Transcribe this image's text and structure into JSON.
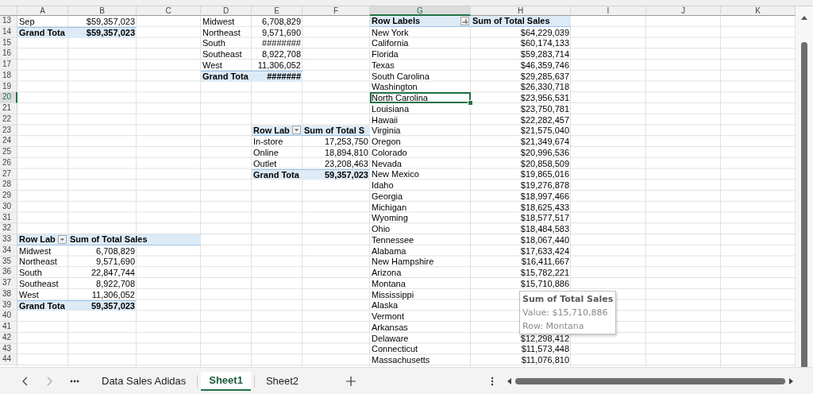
{
  "columns": [
    {
      "label": "A",
      "selected": false
    },
    {
      "label": "B",
      "selected": false
    },
    {
      "label": "C",
      "selected": false
    },
    {
      "label": "D",
      "selected": false
    },
    {
      "label": "E",
      "selected": false
    },
    {
      "label": "F",
      "selected": false
    },
    {
      "label": "G",
      "selected": true
    },
    {
      "label": "H",
      "selected": false
    },
    {
      "label": "I",
      "selected": false
    },
    {
      "label": "J",
      "selected": false
    },
    {
      "label": "K",
      "selected": false
    }
  ],
  "rows": [
    {
      "label": "13",
      "selected": false,
      "cells": [
        {
          "text": "Sep",
          "kind": "label"
        },
        {
          "text": "$59,357,023",
          "kind": "value"
        },
        null,
        {
          "text": "Midwest",
          "kind": "label"
        },
        {
          "text": "6,708,829",
          "kind": "value"
        },
        null,
        {
          "text": "Row Labels",
          "kind": "label",
          "header": true,
          "filter": true,
          "sorted": true
        },
        {
          "text": "Sum of Total Sales",
          "kind": "label",
          "header": true
        }
      ]
    },
    {
      "label": "14",
      "selected": false,
      "cells": [
        {
          "text": "Grand Tota",
          "kind": "label",
          "total": true
        },
        {
          "text": "$59,357,023",
          "kind": "value",
          "total": true
        },
        null,
        {
          "text": "Northeast",
          "kind": "label"
        },
        {
          "text": "9,571,690",
          "kind": "value"
        },
        null,
        {
          "text": "New York",
          "kind": "label"
        },
        {
          "text": "$64,229,039",
          "kind": "value"
        }
      ]
    },
    {
      "label": "15",
      "selected": false,
      "cells": [
        null,
        null,
        null,
        {
          "text": "South",
          "kind": "label"
        },
        {
          "text": "########",
          "kind": "value"
        },
        null,
        {
          "text": "California",
          "kind": "label"
        },
        {
          "text": "$60,174,133",
          "kind": "value"
        }
      ]
    },
    {
      "label": "16",
      "selected": false,
      "cells": [
        null,
        null,
        null,
        {
          "text": "Southeast",
          "kind": "label"
        },
        {
          "text": "8,922,708",
          "kind": "value"
        },
        null,
        {
          "text": "Florida",
          "kind": "label"
        },
        {
          "text": "$59,283,714",
          "kind": "value"
        }
      ]
    },
    {
      "label": "17",
      "selected": false,
      "cells": [
        null,
        null,
        null,
        {
          "text": "West",
          "kind": "label"
        },
        {
          "text": "11,306,052",
          "kind": "value"
        },
        null,
        {
          "text": "Texas",
          "kind": "label"
        },
        {
          "text": "$46,359,746",
          "kind": "value"
        }
      ]
    },
    {
      "label": "18",
      "selected": false,
      "cells": [
        null,
        null,
        null,
        {
          "text": "Grand Tota",
          "kind": "label",
          "total": true
        },
        {
          "text": "#######",
          "kind": "value",
          "total": true
        },
        null,
        {
          "text": "South Carolina",
          "kind": "label"
        },
        {
          "text": "$29,285,637",
          "kind": "value"
        }
      ]
    },
    {
      "label": "19",
      "selected": false,
      "cells": [
        null,
        null,
        null,
        null,
        null,
        null,
        {
          "text": "Washington",
          "kind": "label"
        },
        {
          "text": "$26,330,718",
          "kind": "value"
        }
      ]
    },
    {
      "label": "20",
      "selected": true,
      "cells": [
        null,
        null,
        null,
        null,
        null,
        null,
        {
          "text": "North Carolina",
          "kind": "label"
        },
        {
          "text": "$23,956,531",
          "kind": "value"
        }
      ]
    },
    {
      "label": "21",
      "selected": false,
      "cells": [
        null,
        null,
        null,
        null,
        null,
        null,
        {
          "text": "Louisiana",
          "kind": "label"
        },
        {
          "text": "$23,750,781",
          "kind": "value"
        }
      ]
    },
    {
      "label": "22",
      "selected": false,
      "cells": [
        null,
        null,
        null,
        null,
        null,
        null,
        {
          "text": "Hawaii",
          "kind": "label"
        },
        {
          "text": "$22,282,457",
          "kind": "value"
        }
      ]
    },
    {
      "label": "23",
      "selected": false,
      "cells": [
        null,
        null,
        null,
        null,
        {
          "text": "Row Lab",
          "kind": "label",
          "header": true,
          "filter": true,
          "sorted": false
        },
        {
          "text": "Sum of Total S",
          "kind": "label",
          "header": true
        },
        {
          "text": "Virginia",
          "kind": "label"
        },
        {
          "text": "$21,575,040",
          "kind": "value"
        }
      ]
    },
    {
      "label": "24",
      "selected": false,
      "cells": [
        null,
        null,
        null,
        null,
        {
          "text": "In-store",
          "kind": "label"
        },
        {
          "text": "17,253,750",
          "kind": "value"
        },
        {
          "text": "Oregon",
          "kind": "label"
        },
        {
          "text": "$21,349,674",
          "kind": "value"
        }
      ]
    },
    {
      "label": "25",
      "selected": false,
      "cells": [
        null,
        null,
        null,
        null,
        {
          "text": "Online",
          "kind": "label"
        },
        {
          "text": "18,894,810",
          "kind": "value"
        },
        {
          "text": "Colorado",
          "kind": "label"
        },
        {
          "text": "$20,996,536",
          "kind": "value"
        }
      ]
    },
    {
      "label": "26",
      "selected": false,
      "cells": [
        null,
        null,
        null,
        null,
        {
          "text": "Outlet",
          "kind": "label"
        },
        {
          "text": "23,208,463",
          "kind": "value"
        },
        {
          "text": "Nevada",
          "kind": "label"
        },
        {
          "text": "$20,858,509",
          "kind": "value"
        }
      ]
    },
    {
      "label": "27",
      "selected": false,
      "cells": [
        null,
        null,
        null,
        null,
        {
          "text": "Grand Tota",
          "kind": "label",
          "total": true
        },
        {
          "text": "59,357,023",
          "kind": "value",
          "total": true
        },
        {
          "text": "New Mexico",
          "kind": "label"
        },
        {
          "text": "$19,865,016",
          "kind": "value"
        }
      ]
    },
    {
      "label": "28",
      "selected": false,
      "cells": [
        null,
        null,
        null,
        null,
        null,
        null,
        {
          "text": "Idaho",
          "kind": "label"
        },
        {
          "text": "$19,276,878",
          "kind": "value"
        }
      ]
    },
    {
      "label": "29",
      "selected": false,
      "cells": [
        null,
        null,
        null,
        null,
        null,
        null,
        {
          "text": "Georgia",
          "kind": "label"
        },
        {
          "text": "$18,997,466",
          "kind": "value"
        }
      ]
    },
    {
      "label": "30",
      "selected": false,
      "cells": [
        null,
        null,
        null,
        null,
        null,
        null,
        {
          "text": "Michigan",
          "kind": "label"
        },
        {
          "text": "$18,625,433",
          "kind": "value"
        }
      ]
    },
    {
      "label": "31",
      "selected": false,
      "cells": [
        null,
        null,
        null,
        null,
        null,
        null,
        {
          "text": "Wyoming",
          "kind": "label"
        },
        {
          "text": "$18,577,517",
          "kind": "value"
        }
      ]
    },
    {
      "label": "32",
      "selected": false,
      "cells": [
        null,
        null,
        null,
        null,
        null,
        null,
        {
          "text": "Ohio",
          "kind": "label"
        },
        {
          "text": "$18,484,583",
          "kind": "value"
        }
      ]
    },
    {
      "label": "33",
      "selected": false,
      "cells": [
        {
          "text": "Row Lab",
          "kind": "label",
          "header": true,
          "filter": true,
          "sorted": false
        },
        {
          "text": "Sum of Total Sales",
          "kind": "label",
          "header": true
        },
        null,
        null,
        null,
        null,
        {
          "text": "Tennessee",
          "kind": "label"
        },
        {
          "text": "$18,067,440",
          "kind": "value"
        }
      ]
    },
    {
      "label": "34",
      "selected": false,
      "cells": [
        {
          "text": "Midwest",
          "kind": "label"
        },
        {
          "text": "6,708,829",
          "kind": "value"
        },
        null,
        null,
        null,
        null,
        {
          "text": "Alabama",
          "kind": "label"
        },
        {
          "text": "$17,633,424",
          "kind": "value"
        }
      ]
    },
    {
      "label": "35",
      "selected": false,
      "cells": [
        {
          "text": "Northeast",
          "kind": "label"
        },
        {
          "text": "9,571,690",
          "kind": "value"
        },
        null,
        null,
        null,
        null,
        {
          "text": "New Hampshire",
          "kind": "label"
        },
        {
          "text": "$16,411,667",
          "kind": "value"
        }
      ]
    },
    {
      "label": "36",
      "selected": false,
      "cells": [
        {
          "text": "South",
          "kind": "label"
        },
        {
          "text": "22,847,744",
          "kind": "value"
        },
        null,
        null,
        null,
        null,
        {
          "text": "Arizona",
          "kind": "label"
        },
        {
          "text": "$15,782,221",
          "kind": "value"
        }
      ]
    },
    {
      "label": "37",
      "selected": false,
      "cells": [
        {
          "text": "Southeast",
          "kind": "label"
        },
        {
          "text": "8,922,708",
          "kind": "value"
        },
        null,
        null,
        null,
        null,
        {
          "text": "Montana",
          "kind": "label"
        },
        {
          "text": "$15,710,886",
          "kind": "value"
        }
      ]
    },
    {
      "label": "38",
      "selected": false,
      "cells": [
        {
          "text": "West",
          "kind": "label"
        },
        {
          "text": "11,306,052",
          "kind": "value"
        },
        null,
        null,
        null,
        null,
        {
          "text": "Mississippi",
          "kind": "label"
        }
      ]
    },
    {
      "label": "39",
      "selected": false,
      "cells": [
        {
          "text": "Grand Tota",
          "kind": "label",
          "total": true
        },
        {
          "text": "59,357,023",
          "kind": "value",
          "total": true
        },
        null,
        null,
        null,
        null,
        {
          "text": "Alaska",
          "kind": "label"
        }
      ]
    },
    {
      "label": "40",
      "selected": false,
      "cells": [
        null,
        null,
        null,
        null,
        null,
        null,
        {
          "text": "Vermont",
          "kind": "label"
        }
      ]
    },
    {
      "label": "41",
      "selected": false,
      "cells": [
        null,
        null,
        null,
        null,
        null,
        null,
        {
          "text": "Arkansas",
          "kind": "label"
        }
      ]
    },
    {
      "label": "42",
      "selected": false,
      "cells": [
        null,
        null,
        null,
        null,
        null,
        null,
        {
          "text": "Delaware",
          "kind": "label"
        },
        {
          "text": "$12,298,412",
          "kind": "value"
        }
      ]
    },
    {
      "label": "43",
      "selected": false,
      "cells": [
        null,
        null,
        null,
        null,
        null,
        null,
        {
          "text": "Connecticut",
          "kind": "label"
        },
        {
          "text": "$11,573,448",
          "kind": "value"
        }
      ]
    },
    {
      "label": "44",
      "selected": false,
      "cells": [
        null,
        null,
        null,
        null,
        null,
        null,
        {
          "text": "Massachusetts",
          "kind": "label"
        },
        {
          "text": "$11,076,810",
          "kind": "value"
        }
      ]
    }
  ],
  "tooltip": {
    "title": "Sum of Total Sales",
    "lines": [
      "Value: $15,710,886",
      "Row: Montana"
    ]
  },
  "sheet_tabs": [
    {
      "label": "Data Sales Adidas",
      "selected": false
    },
    {
      "label": "Sheet1",
      "selected": true
    },
    {
      "label": "Sheet2",
      "selected": false
    }
  ]
}
